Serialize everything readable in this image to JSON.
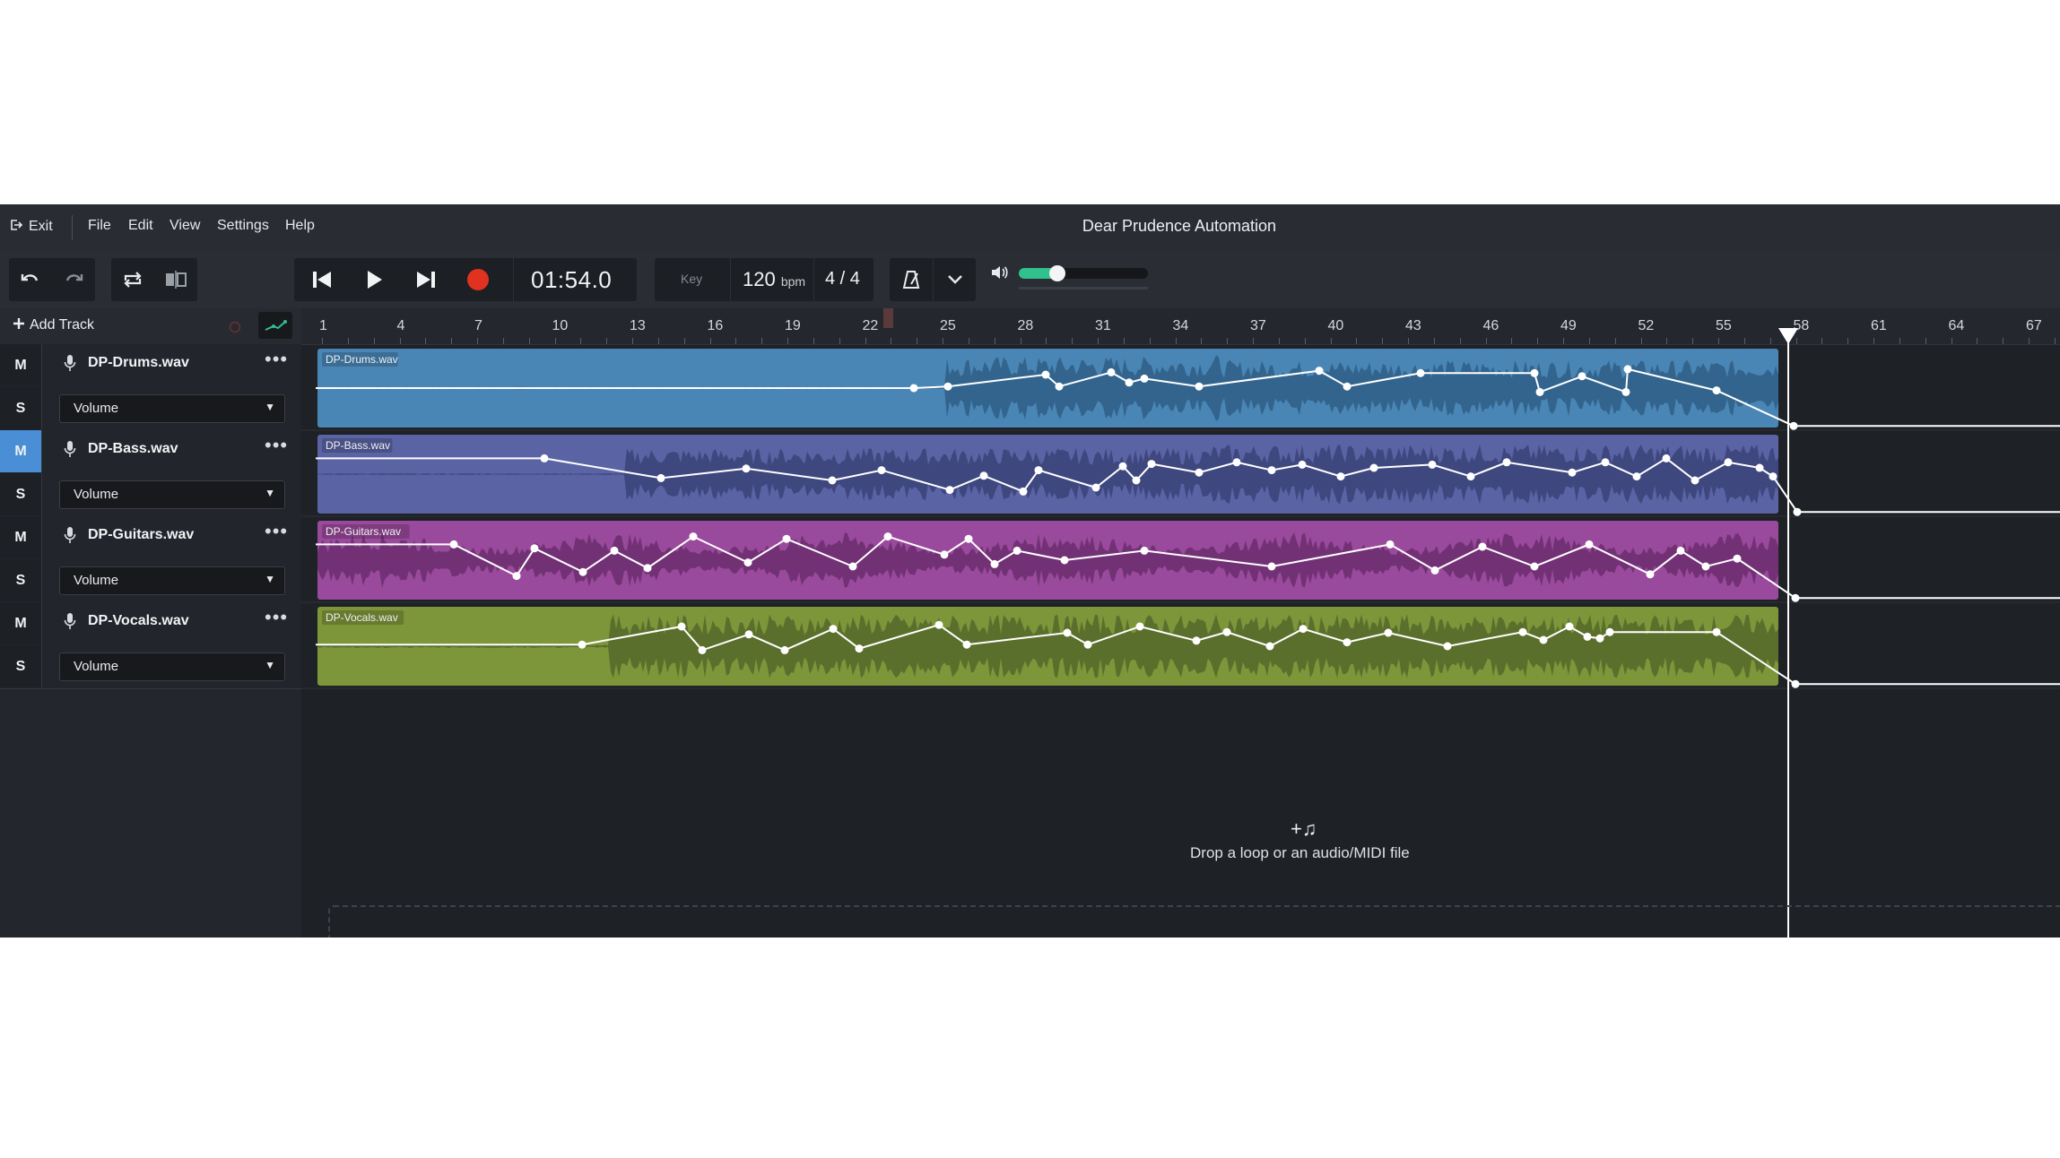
{
  "menu": {
    "exit_label": "Exit",
    "items": [
      "File",
      "Edit",
      "View",
      "Settings",
      "Help"
    ],
    "title": "Dear Prudence Automation"
  },
  "transport": {
    "time": "01:54.0",
    "key_label": "Key",
    "tempo_value": "120",
    "tempo_unit": "bpm",
    "time_signature": "4 / 4",
    "volume_level": 0.26,
    "record_color": "#e0321e"
  },
  "left_panel": {
    "add_track_label": "Add Track"
  },
  "ruler": {
    "bars": [
      "1",
      "4",
      "7",
      "10",
      "13",
      "16",
      "19",
      "22",
      "25",
      "28",
      "31",
      "34",
      "37",
      "40",
      "43",
      "46",
      "49",
      "52",
      "55",
      "58",
      "61",
      "64",
      "67"
    ]
  },
  "tracks": [
    {
      "name": "DP-Drums.wav",
      "mute": "M",
      "solo": "S",
      "muted": false,
      "param": "Volume",
      "clip_label": "DP-Drums.wav",
      "color": "#4a86b5",
      "wave_color": "#2e5e86"
    },
    {
      "name": "DP-Bass.wav",
      "mute": "M",
      "solo": "S",
      "muted": true,
      "param": "Volume",
      "clip_label": "DP-Bass.wav",
      "color": "#5a63a4",
      "wave_color": "#3a4278"
    },
    {
      "name": "DP-Guitars.wav",
      "mute": "M",
      "solo": "S",
      "muted": false,
      "param": "Volume",
      "clip_label": "DP-Guitars.wav",
      "color": "#9a4a9c",
      "wave_color": "#6b2d6e"
    },
    {
      "name": "DP-Vocals.wav",
      "mute": "M",
      "solo": "S",
      "muted": false,
      "param": "Volume",
      "clip_label": "DP-Vocals.wav",
      "color": "#7d963a",
      "wave_color": "#55692a"
    }
  ],
  "dropzone": {
    "icon": "+♫",
    "text": "Drop a loop or an audio/MIDI file"
  },
  "colors": {
    "accent_green": "#31c18d",
    "mute_active": "#4a8fd6",
    "playhead": "#ffffff"
  }
}
